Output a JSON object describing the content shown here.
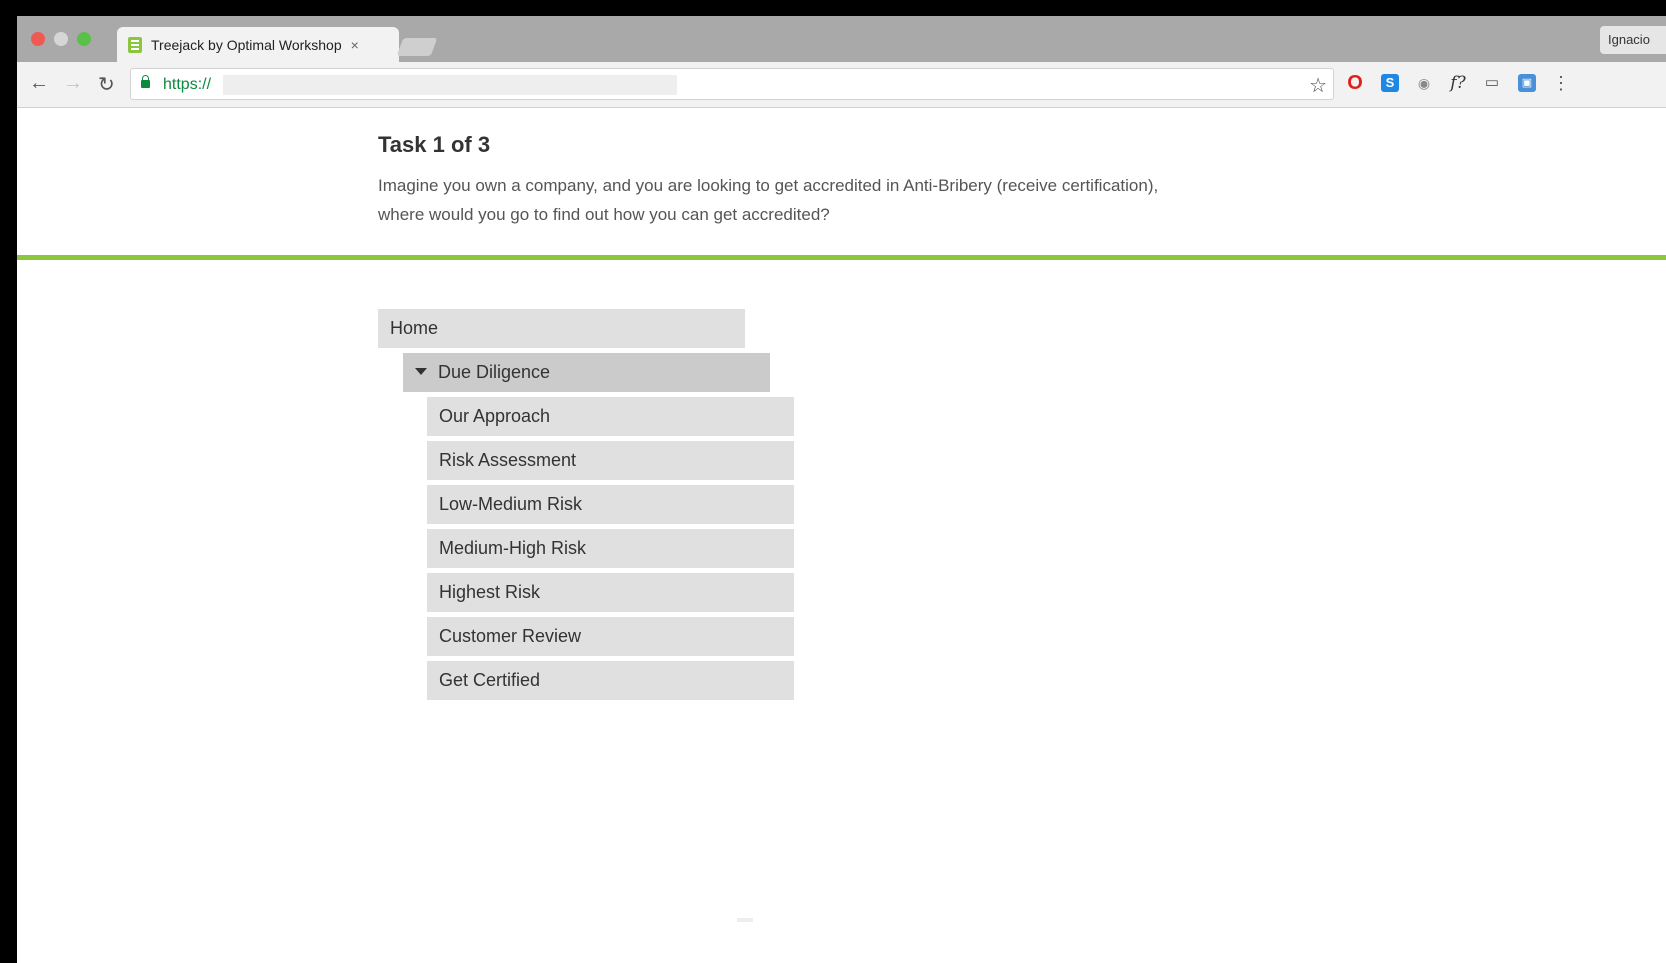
{
  "browser": {
    "tab_title": "Treejack by Optimal Workshop",
    "tab_close": "×",
    "profile_name": "Ignacio",
    "url": "https://",
    "colors": {
      "url_green": "#0b8a3e",
      "tab_strip": "#a9a9a9"
    }
  },
  "task": {
    "title": "Task 1 of 3",
    "description": "Imagine you own a company, and you are looking to get accredited in Anti-Bribery (receive certification), where would you go to find out how you can get accredited?"
  },
  "tree": {
    "accent_color": "#8cc63f",
    "home": "Home",
    "expanded_node": "Due Diligence",
    "children": [
      "Our Approach",
      "Risk Assessment",
      "Low-Medium Risk",
      "Medium-High Risk",
      "Highest Risk",
      "Customer Review",
      "Get Certified"
    ]
  }
}
